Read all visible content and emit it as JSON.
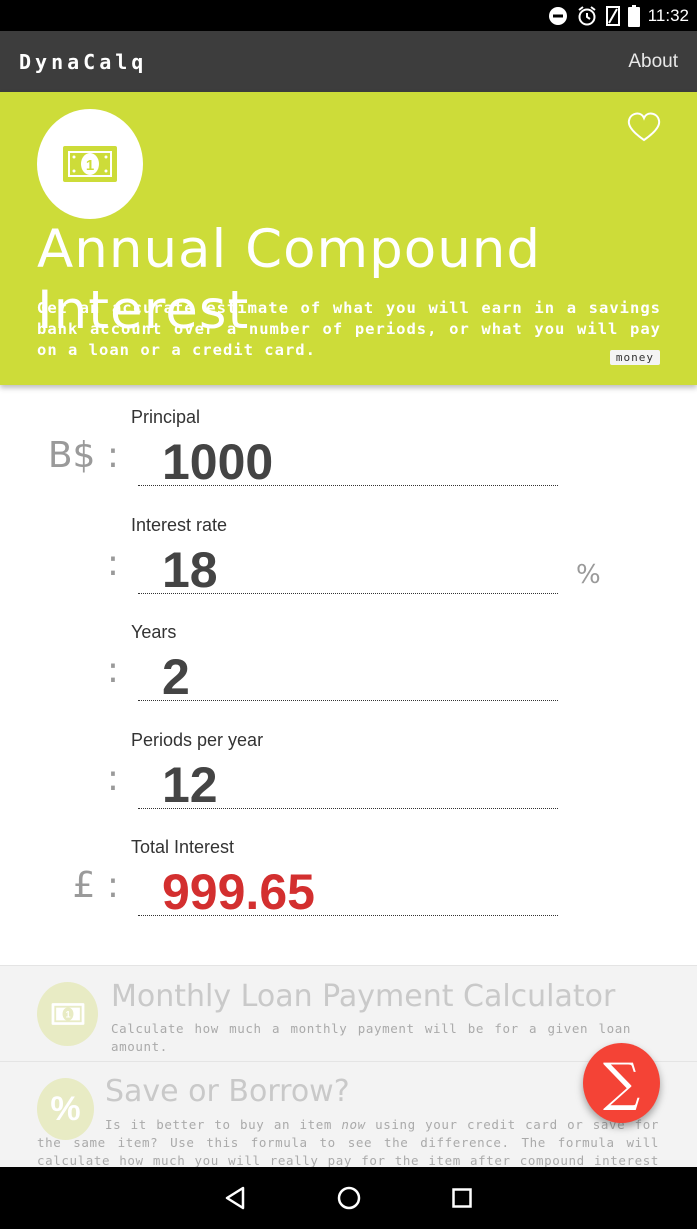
{
  "status_bar": {
    "time": "11:32",
    "icons": [
      "do-not-disturb-icon",
      "alarm-icon",
      "signal-icon",
      "battery-icon"
    ]
  },
  "app_bar": {
    "title": "DynaCalq",
    "about": "About"
  },
  "hero": {
    "icon": "banknote-icon",
    "favorite_icon": "heart-outline-icon",
    "title": "Annual Compound Interest",
    "description": "Get an accurate estimate of what you will earn in a savings bank account over a number of periods, or what you will pay on a loan or a credit card.",
    "tag": "money",
    "color": "#cddc39"
  },
  "fields": [
    {
      "label": "Principal",
      "prefix": "B$ :",
      "value": "1000",
      "suffix": ""
    },
    {
      "label": "Interest rate",
      "prefix": ":",
      "value": "18",
      "suffix": "%"
    },
    {
      "label": "Years",
      "prefix": ":",
      "value": "2",
      "suffix": ""
    },
    {
      "label": "Periods per year",
      "prefix": ":",
      "value": "12",
      "suffix": ""
    },
    {
      "label": "Total Interest",
      "prefix": "£ :",
      "value": "999.65",
      "suffix": ""
    }
  ],
  "result_color": "#d32f2f",
  "related": [
    {
      "icon": "banknote-icon",
      "title": "Monthly Loan Payment Calculator",
      "description": "Calculate how much a monthly payment will be for a given loan amount."
    },
    {
      "icon": "percent-icon",
      "title": "Save or Borrow?",
      "description_before": "Is it better to buy an item ",
      "description_emphasis": "now",
      "description_after": " using your credit card or save for the same item? Use this formula to see the difference. The formula will calculate how much you will really pay for the item after compound interest is applied."
    }
  ],
  "fab": {
    "icon": "sigma-icon",
    "glyph": "∑",
    "color": "#f44336"
  },
  "nav": [
    "back-icon",
    "home-icon",
    "recents-icon"
  ]
}
